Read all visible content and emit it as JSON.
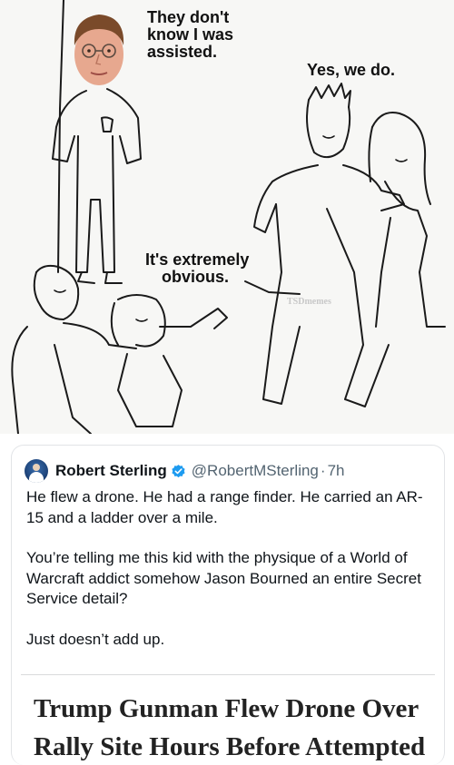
{
  "meme": {
    "speech_top_left": [
      "They don't",
      "know I was",
      "assisted."
    ],
    "speech_top_right": "Yes, we do.",
    "speech_bottom": [
      "It's extremely",
      "obvious."
    ],
    "watermark": "TSDmemes"
  },
  "tweet": {
    "author_name": "Robert Sterling",
    "handle": "@RobertMSterling",
    "separator": "·",
    "time": "7h",
    "verified_color": "#1d9bf0",
    "paragraphs": [
      "He flew a drone. He had a range finder. He carried an AR-15 and a ladder over a mile.",
      "You’re telling me this kid with the physique of a World of Warcraft addict somehow Jason Bourned an entire Secret Service detail?",
      "Just doesn’t add up."
    ],
    "article_headline": "Trump Gunman Flew Drone Over Rally Site Hours Before Attempted"
  }
}
